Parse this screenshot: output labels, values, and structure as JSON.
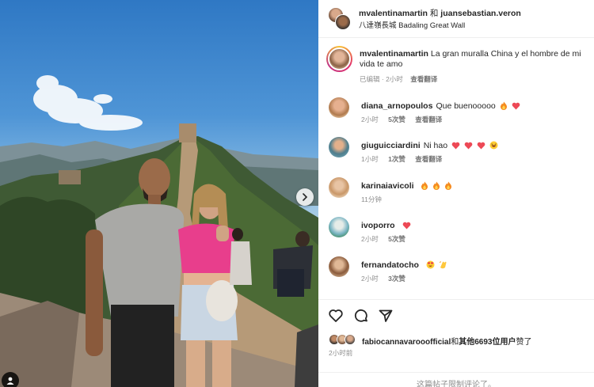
{
  "header": {
    "user1": "mvalentinamartin",
    "conj": "和",
    "user2": "juansebastian.veron",
    "location": "八達嶺長城 Badaling Great Wall"
  },
  "caption": {
    "username": "mvalentinamartin",
    "text": "La gran muralla China y el hombre de mi vida te amo",
    "edited": "已编辑",
    "time": "2小时",
    "translate": "查看翻译"
  },
  "comments": [
    {
      "username": "diana_arnopoulos",
      "text": "Que buenooooo",
      "emojis": [
        "fire",
        "heart"
      ],
      "time": "2小时",
      "likes": "5次赞",
      "translate": "查看翻译"
    },
    {
      "username": "giuguicciardini",
      "text": "Ni hao",
      "emojis": [
        "heart",
        "heart",
        "heart",
        "laugh"
      ],
      "time": "1小时",
      "likes": "1次赞",
      "translate": "查看翻译"
    },
    {
      "username": "karinaiavicoli",
      "text": "",
      "emojis": [
        "fire",
        "fire",
        "fire"
      ],
      "time": "11分钟",
      "likes": "",
      "translate": ""
    },
    {
      "username": "ivoporro",
      "text": "",
      "emojis": [
        "heart"
      ],
      "time": "2小时",
      "likes": "5次赞",
      "translate": ""
    },
    {
      "username": "fernandatocho",
      "text": "",
      "emojis": [
        "heart-eyes",
        "clap"
      ],
      "time": "2小时",
      "likes": "3次赞",
      "translate": ""
    }
  ],
  "likes": {
    "user": "fabiocannavarooofficial",
    "and": "和",
    "others": "其他6693位用户",
    "suffix": "赞了"
  },
  "post_time": "2小时前",
  "comments_disabled": "这篇帖子限制评论了。",
  "icons": {
    "like": "heart-outline-icon",
    "comment": "comment-bubble-icon",
    "share": "paper-plane-icon",
    "next": "chevron-right-icon",
    "tag": "user-tag-icon"
  },
  "colors": {
    "text": "#262626",
    "secondary": "#8e8e8e",
    "heart": "#ed4956",
    "fire": "#f58a1f"
  }
}
